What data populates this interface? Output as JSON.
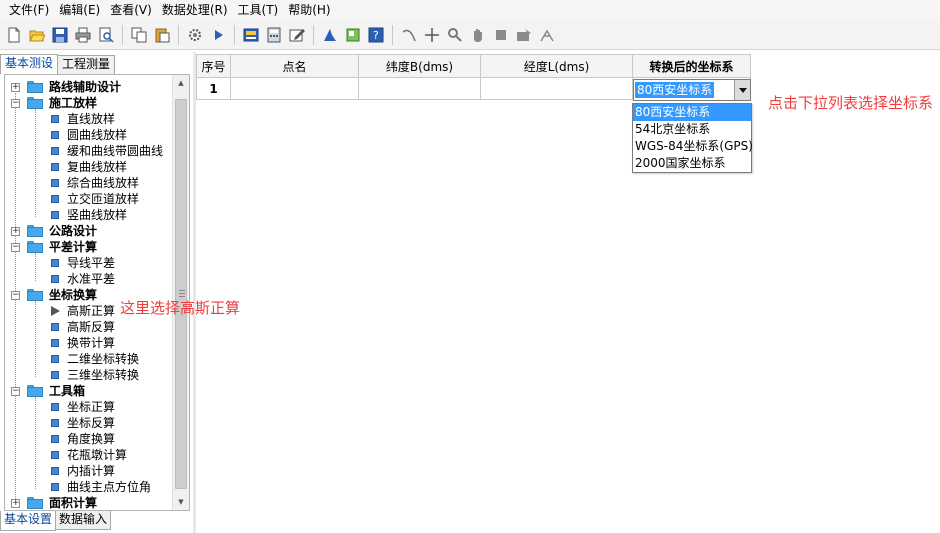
{
  "menubar": [
    {
      "label": "文件(F)"
    },
    {
      "label": "编辑(E)"
    },
    {
      "label": "查看(V)"
    },
    {
      "label": "数据处理(R)"
    },
    {
      "label": "工具(T)"
    },
    {
      "label": "帮助(H)"
    }
  ],
  "toolbar": {
    "icons": [
      "new-file-icon",
      "open-folder-icon",
      "save-icon",
      "print-icon",
      "print-preview-icon",
      "copy-icon",
      "paste-icon",
      "settings-gear-icon",
      "run-icon",
      "calculator-screen-icon",
      "calculator-icon",
      "edit-note-icon",
      "chart-icon",
      "export-icon",
      "help-icon",
      "curve-icon",
      "crosshair-icon",
      "zoom-icon",
      "pan-hand-icon",
      "stop-icon",
      "camera-icon",
      "measure-icon"
    ]
  },
  "left_tabs": {
    "basic_survey": "基本测设",
    "engineering_survey": "工程测量"
  },
  "tree": {
    "route_aux": "路线辅助设计",
    "construction": "施工放样",
    "construction_items": [
      "直线放样",
      "圆曲线放样",
      "缓和曲线带圆曲线",
      "复曲线放样",
      "综合曲线放样",
      "立交匝道放样",
      "竖曲线放样"
    ],
    "highway": "公路设计",
    "adjustment": "平差计算",
    "adjustment_items": [
      "导线平差",
      "水准平差"
    ],
    "coord": "坐标换算",
    "coord_items": [
      "高斯正算",
      "高斯反算",
      "换带计算",
      "二维坐标转换",
      "三维坐标转换"
    ],
    "toolbox": "工具箱",
    "toolbox_items": [
      "坐标正算",
      "坐标反算",
      "角度换算",
      "花瓶墩计算",
      "内插计算",
      "曲线主点方位角"
    ],
    "area": "面积计算"
  },
  "bottom_tabs": {
    "basic_settings": "基本设置",
    "data_input": "数据输入"
  },
  "grid": {
    "headers": [
      "序号",
      "点名",
      "纬度B(dms)",
      "经度L(dms)",
      "转换后的坐标系"
    ],
    "row_number": "1",
    "combo_value": "80西安坐标系"
  },
  "dropdown": {
    "options": [
      "80西安坐标系",
      "54北京坐标系",
      "WGS-84坐标系(GPS)",
      "2000国家坐标系"
    ],
    "selected_index": 0
  },
  "annotations": {
    "dropdown_hint": "点击下拉列表选择坐标系",
    "gauss_hint": "这里选择高斯正算",
    "color": "#f23c3c"
  }
}
